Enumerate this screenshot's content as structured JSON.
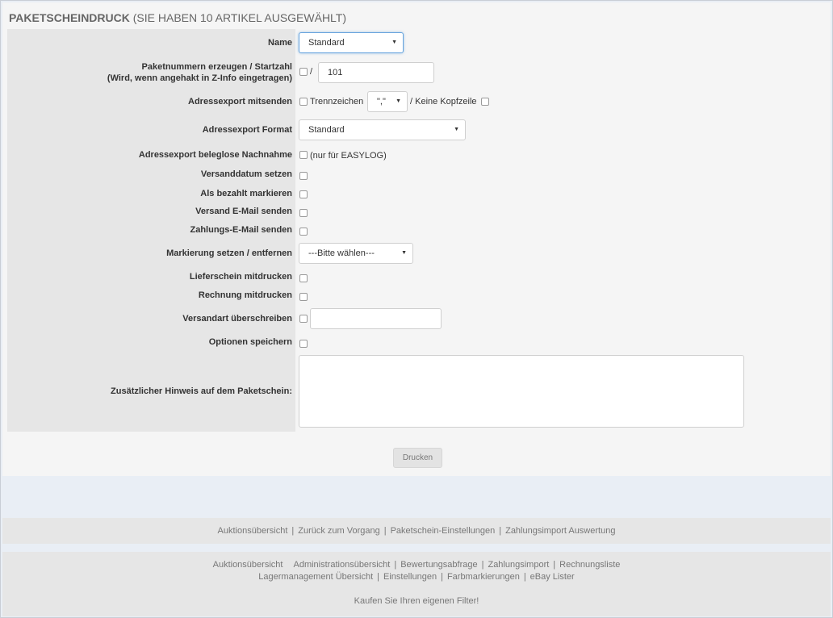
{
  "header": {
    "title_strong": "PAKETSCHEINDRUCK",
    "title_rest": " (SIE HABEN 10 ARTIKEL AUSGEWÄHLT)"
  },
  "form": {
    "name": {
      "label": "Name",
      "value": "Standard"
    },
    "paketnummern": {
      "label_line1": "Paketnummern erzeugen / Startzahl",
      "label_line2": "(Wird, wenn angehakt in Z-Info eingetragen)",
      "slash": "/",
      "value": "101"
    },
    "adressexport": {
      "label": "Adressexport mitsenden",
      "trennzeichen_label": "Trennzeichen",
      "trennzeichen_value": "\",\"",
      "kopfzeile_label": "/ Keine Kopfzeile"
    },
    "adressexport_format": {
      "label": "Adressexport Format",
      "value": "Standard"
    },
    "nachnahme": {
      "label": "Adressexport beleglose Nachnahme",
      "note": "(nur für EASYLOG)"
    },
    "versanddatum": {
      "label": "Versanddatum setzen"
    },
    "bezahlt": {
      "label": "Als bezahlt markieren"
    },
    "versand_mail": {
      "label": "Versand E-Mail senden"
    },
    "zahlungs_mail": {
      "label": "Zahlungs-E-Mail senden"
    },
    "markierung": {
      "label": "Markierung setzen / entfernen",
      "value": "---Bitte wählen---"
    },
    "lieferschein": {
      "label": "Lieferschein mitdrucken"
    },
    "rechnung": {
      "label": "Rechnung mitdrucken"
    },
    "versandart": {
      "label": "Versandart überschreiben",
      "value": ""
    },
    "optionen": {
      "label": "Optionen speichern"
    },
    "hinweis": {
      "label": "Zusätzlicher Hinweis auf dem Paketschein:",
      "value": ""
    },
    "submit_label": "Drucken"
  },
  "footer_nav": {
    "links": [
      "Auktionsübersicht",
      "Zurück zum Vorgang",
      "Paketschein-Einstellungen",
      "Zahlungsimport Auswertung"
    ]
  },
  "footer_main": {
    "line1": [
      "Auktionsübersicht",
      "Administrationsübersicht",
      "Bewertungsabfrage",
      "Zahlungsimport",
      "Rechnungsliste"
    ],
    "line2": [
      "Lagermanagement Übersicht",
      "Einstellungen",
      "Farbmarkierungen",
      "eBay Lister"
    ],
    "tagline": "Kaufen Sie Ihren eigenen Filter!"
  }
}
